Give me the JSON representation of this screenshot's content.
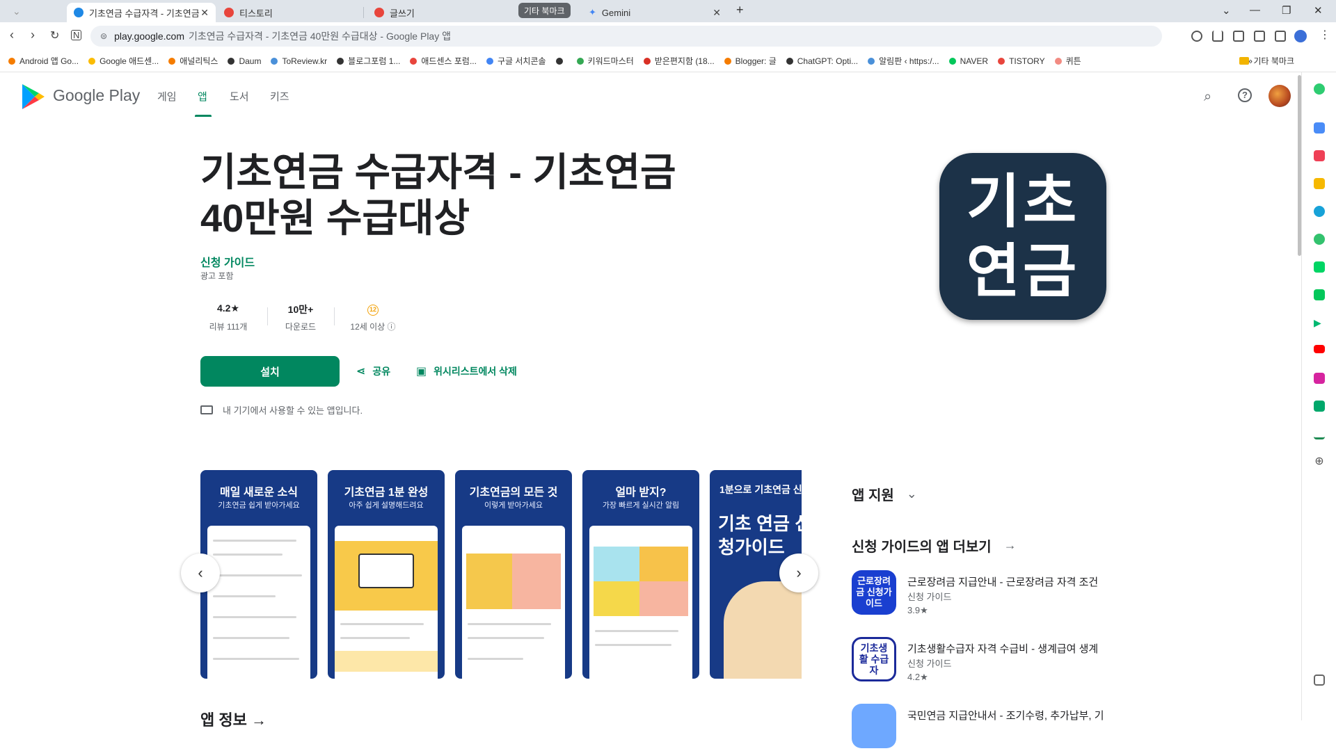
{
  "browser": {
    "tabs": [
      {
        "label": "기초연금 수급자격 - 기초연금",
        "active": true,
        "color": "#1e88e5"
      },
      {
        "label": "티스토리",
        "active": false,
        "color": "#e8453c"
      },
      {
        "label": "글쓰기",
        "active": false,
        "color": "#e8453c"
      },
      {
        "label": "Gemini",
        "active": false,
        "color": "#4285f4"
      }
    ],
    "tab_group": "기타 북마크",
    "new_tab": "+",
    "url_host": "play.google.com",
    "url_rest": "기초연금 수급자격 - 기초연금 40만원 수급대상 - Google Play 앱",
    "bookmarks": [
      {
        "label": "Android 앱 Go...",
        "color": "#f57c00"
      },
      {
        "label": "Google 애드센...",
        "color": "#fbbc04"
      },
      {
        "label": "애널리틱스",
        "color": "#f57c00"
      },
      {
        "label": "Daum",
        "color": "#333333"
      },
      {
        "label": "ToReview.kr",
        "color": "#4a90d9"
      },
      {
        "label": "블로그포럼 1...",
        "color": "#333333"
      },
      {
        "label": "애드센스 포럼...",
        "color": "#e8453c"
      },
      {
        "label": "구글 서치콘솔",
        "color": "#4285f4"
      },
      {
        "label": "",
        "color": "#333333"
      },
      {
        "label": "키워드마스터",
        "color": "#34a853"
      },
      {
        "label": "받은편지함 (18...",
        "color": "#d93025"
      },
      {
        "label": "Blogger: 글",
        "color": "#f57c00"
      },
      {
        "label": "ChatGPT: Opti...",
        "color": "#333333"
      },
      {
        "label": "알림판 ‹ https:/...",
        "color": "#4a90d9"
      },
      {
        "label": "NAVER",
        "color": "#03c75a"
      },
      {
        "label": "TISTORY",
        "color": "#e8453c"
      },
      {
        "label": "퀴튼",
        "color": "#f28b82"
      }
    ],
    "bookmarks_more": "»",
    "bookmarks_folder": "기타 북마크"
  },
  "play": {
    "brand": "Google Play",
    "nav": [
      "게임",
      "앱",
      "도서",
      "키즈"
    ],
    "active_nav": "앱"
  },
  "app": {
    "title_line1": "기초연금 수급자격 - 기초연금",
    "title_line2": "40만원 수급대상",
    "developer": "신청 가이드",
    "ads": "광고 포함",
    "rating_value": "4.2★",
    "rating_label": "리뷰 111개",
    "downloads_value": "10만+",
    "downloads_label": "다운로드",
    "age_icon": "12",
    "age_label": "12세 이상 ⓘ",
    "install": "설치",
    "share": "공유",
    "wishlist": "위시리스트에서 삭제",
    "device_note": "내 기기에서 사용할 수 있는 앱입니다.",
    "icon_line1": "기초",
    "icon_line2": "연금",
    "icon_bg": "#1c3248"
  },
  "screenshots": [
    {
      "title": "매일 새로운 소식",
      "subtitle": "기초연금 쉽게 받아가세요"
    },
    {
      "title": "기초연금 1분 완성",
      "subtitle": "아주 쉽게 설명해드려요"
    },
    {
      "title": "기초연금의 모든 것",
      "subtitle": "이렇게 받아가세요"
    },
    {
      "title": "얼마 받지?",
      "subtitle": "가장 빠르게 실시간 알림"
    },
    {
      "title": "1분으로 기초연금 신",
      "subtitle": "",
      "big": "기초 연금 신청가이드"
    }
  ],
  "about_heading": "앱 정보 →",
  "sidebar": {
    "support": "앱 지원",
    "more_heading": "신청 가이드의 앱 더보기",
    "related": [
      {
        "name": "근로장려금 지급안내 - 근로장려금 자격 조건",
        "dev": "신청 가이드",
        "rating": "3.9★",
        "icon": "근로장려금 신청가이드",
        "bg": "#1a3fd0",
        "fg": "#ffffff"
      },
      {
        "name": "기초생활수급자 자격 수급비 - 생계급여 생계",
        "dev": "신청 가이드",
        "rating": "4.2★",
        "icon": "기초생활 수급자",
        "bg": "#ffffff",
        "fg": "#1b2a9a"
      },
      {
        "name": "국민연금 지급안내서 - 조기수령, 추가납부, 기",
        "dev": "",
        "rating": "",
        "icon": "",
        "bg": "#6ea8ff",
        "fg": "#ffffff"
      }
    ]
  }
}
